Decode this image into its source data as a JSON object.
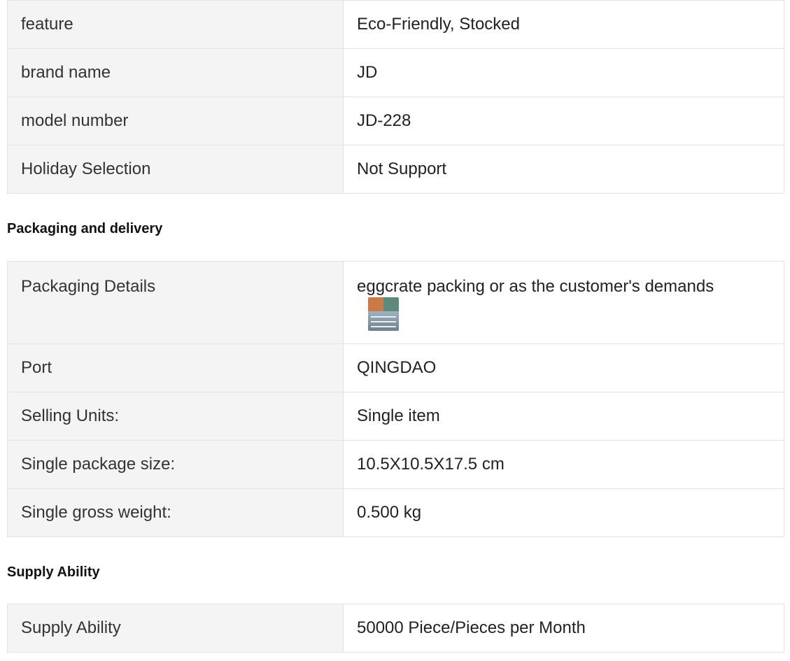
{
  "attributes": {
    "rows": [
      {
        "key": "feature",
        "value": "Eco-Friendly, Stocked"
      },
      {
        "key": "brand name",
        "value": "JD"
      },
      {
        "key": "model number",
        "value": "JD-228"
      },
      {
        "key": "Holiday Selection",
        "value": "Not Support"
      }
    ]
  },
  "packaging": {
    "title": "Packaging and delivery",
    "rows": [
      {
        "key": "Packaging Details",
        "value": "eggcrate packing or as the customer's demands"
      },
      {
        "key": "Port",
        "value": "QINGDAO"
      },
      {
        "key": "Selling Units:",
        "value": "Single item"
      },
      {
        "key": "Single package size:",
        "value": "10.5X10.5X17.5 cm"
      },
      {
        "key": "Single gross weight:",
        "value": "0.500 kg"
      }
    ]
  },
  "supply": {
    "title": "Supply Ability",
    "rows": [
      {
        "key": "Supply Ability",
        "value": "50000 Piece/Pieces per Month"
      }
    ]
  }
}
